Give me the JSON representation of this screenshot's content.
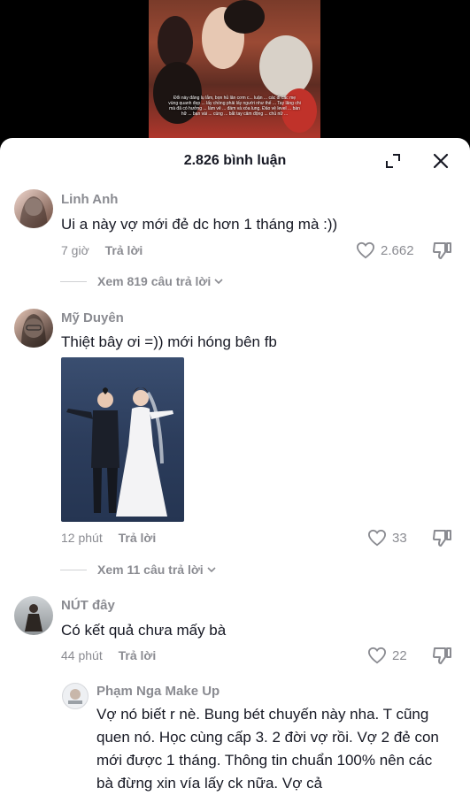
{
  "video": {
    "caption": "Đổi này đăng lụ lắm, bọn hủ lăn cơm c... luận ... các đi các mẹ vùng quanh đẹp ... lấy chồng phải lấy người như thế ... Tay lăng chi mà đã có hưởng ... làm vẻ ... đám và xòa lung. Đảo vẻ level ... bàn hữ ... bạn vài ... cùng ... bắt tay cảm động ... chủ nữ ..."
  },
  "sheet": {
    "comment_count": "2.826 bình luận"
  },
  "comments": [
    {
      "user": "Linh Anh",
      "text": "Ui a này vợ mới đẻ dc hơn 1 tháng mà :))",
      "time": "7 giờ",
      "reply": "Trả lời",
      "likes": "2.662",
      "more_replies": "Xem 819 câu trả lời"
    },
    {
      "user": "Mỹ Duyên",
      "text": "Thiệt bây ơi =)) mới hóng bên fb",
      "time": "12 phút",
      "reply": "Trả lời",
      "likes": "33",
      "more_replies": "Xem 11 câu trả lời"
    },
    {
      "user": "NÚT đây",
      "text": "Có kết quả chưa mấy bà",
      "time": "44 phút",
      "reply": "Trả lời",
      "likes": "22"
    }
  ],
  "nested_reply": {
    "user": "Phạm Nga Make Up",
    "text": "Vợ nó biết r nè. Bung bét chuyến này nha. T cũng quen nó. Học cùng cấp 3. 2 đời vợ rồi. Vợ 2 đẻ con mới được 1 tháng. Thông tin chuẩn 100% nên các bà đừng xin vía lấy ck nữa. Vợ cả"
  },
  "colors": {
    "background": "#000000",
    "sheet": "#ffffff",
    "text_primary": "#161823",
    "text_secondary": "#8a8b91"
  }
}
